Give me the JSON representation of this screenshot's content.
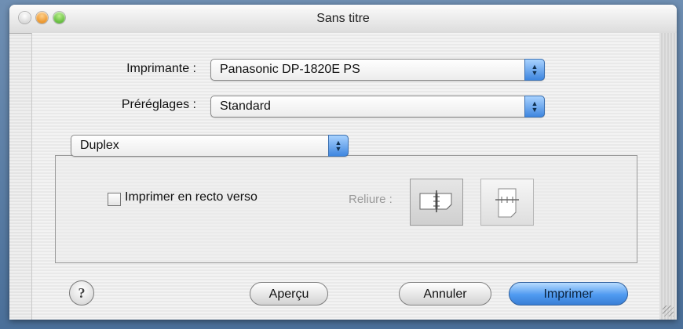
{
  "window": {
    "title": "Sans titre"
  },
  "printer": {
    "label": "Imprimante :",
    "value": "Panasonic DP-1820E PS"
  },
  "presets": {
    "label": "Préréglages :",
    "value": "Standard"
  },
  "panel_menu": {
    "value": "Duplex"
  },
  "duplex": {
    "checkbox_label": "Imprimer en recto verso",
    "checked": false,
    "binding_label": "Reliure :"
  },
  "buttons": {
    "help": "?",
    "preview": "Aperçu",
    "cancel": "Annuler",
    "print": "Imprimer"
  },
  "colors": {
    "accent": "#4f9af0"
  }
}
